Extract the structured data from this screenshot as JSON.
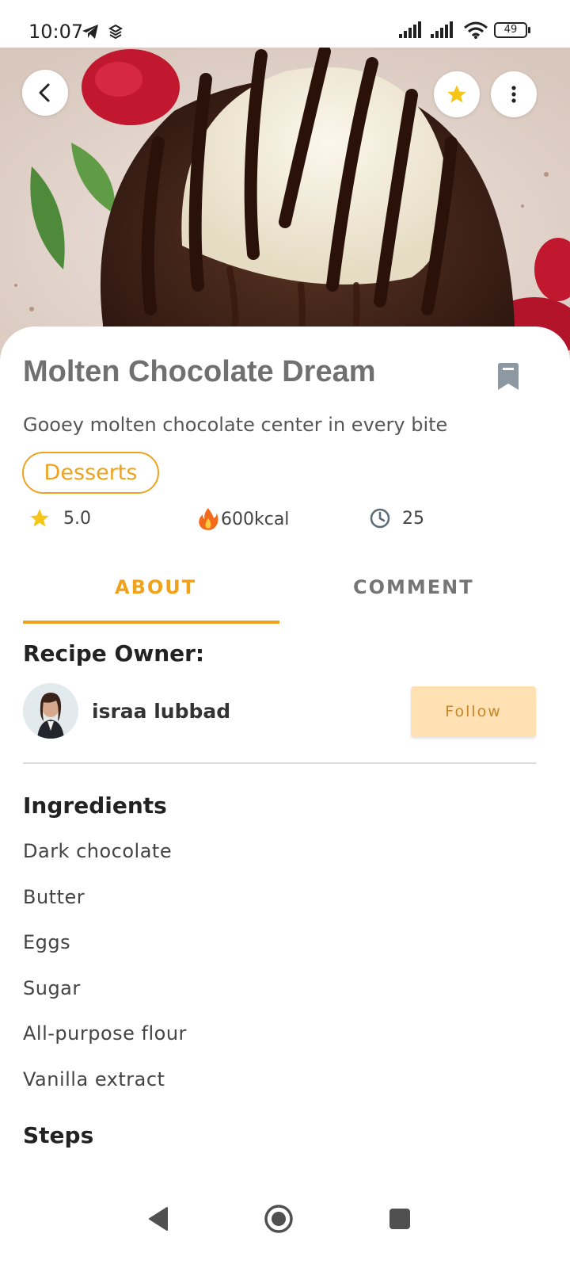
{
  "status_bar": {
    "time": "10:07",
    "battery": "49",
    "icons": [
      "telegram-icon",
      "layers-icon",
      "signal-icon",
      "signal-icon",
      "wifi-icon",
      "battery-icon"
    ]
  },
  "header": {
    "back_icon": "back-arrow-icon",
    "favorite_icon": "star-icon",
    "more_icon": "more-vertical-icon"
  },
  "recipe": {
    "title": "Molten Chocolate Dream",
    "subtitle": "Gooey molten chocolate center in every bite",
    "category": "Desserts",
    "rating": "5.0",
    "calories": "600kcal",
    "time": "25"
  },
  "tabs": [
    {
      "label": "ABOUT",
      "active": true
    },
    {
      "label": "COMMENT",
      "active": false
    }
  ],
  "owner": {
    "section_title": "Recipe Owner:",
    "name": "israa lubbad",
    "follow_label": "Follow"
  },
  "ingredients": {
    "title": "Ingredients",
    "items": [
      "Dark chocolate",
      "Butter",
      "Eggs",
      "Sugar",
      "All-purpose flour",
      "Vanilla extract"
    ]
  },
  "steps": {
    "title": "Steps"
  },
  "colors": {
    "accent": "#f0a21d",
    "follow_bg": "#ffe1b3",
    "title_gray": "#707070"
  }
}
